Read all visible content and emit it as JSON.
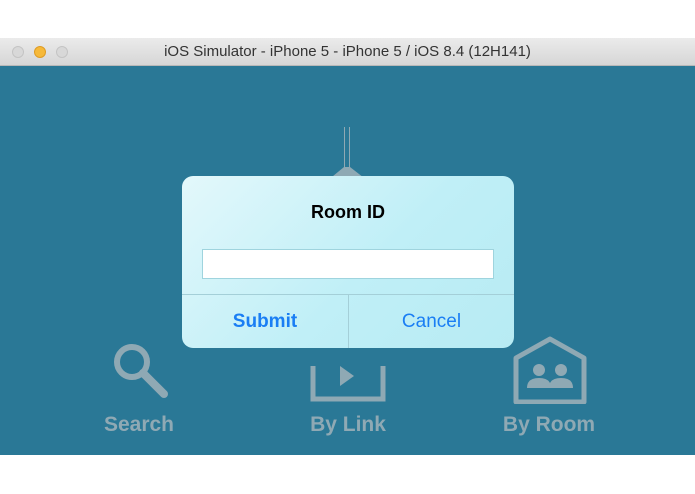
{
  "window": {
    "title": "iOS Simulator - iPhone 5 - iPhone 5 / iOS 8.4 (12H141)"
  },
  "app": {
    "background_color": "#2a7896",
    "logo_icon": "fountain-pen-nib-icon",
    "tiles": [
      {
        "label": "Search",
        "icon": "magnifier-icon"
      },
      {
        "label": "By Link",
        "icon": "link-screen-icon"
      },
      {
        "label": "By Room",
        "icon": "room-house-icon"
      }
    ]
  },
  "dialog": {
    "title": "Room ID",
    "input_value": "",
    "input_placeholder": "",
    "submit_label": "Submit",
    "cancel_label": "Cancel",
    "accent_color": "#1a7ef4"
  }
}
